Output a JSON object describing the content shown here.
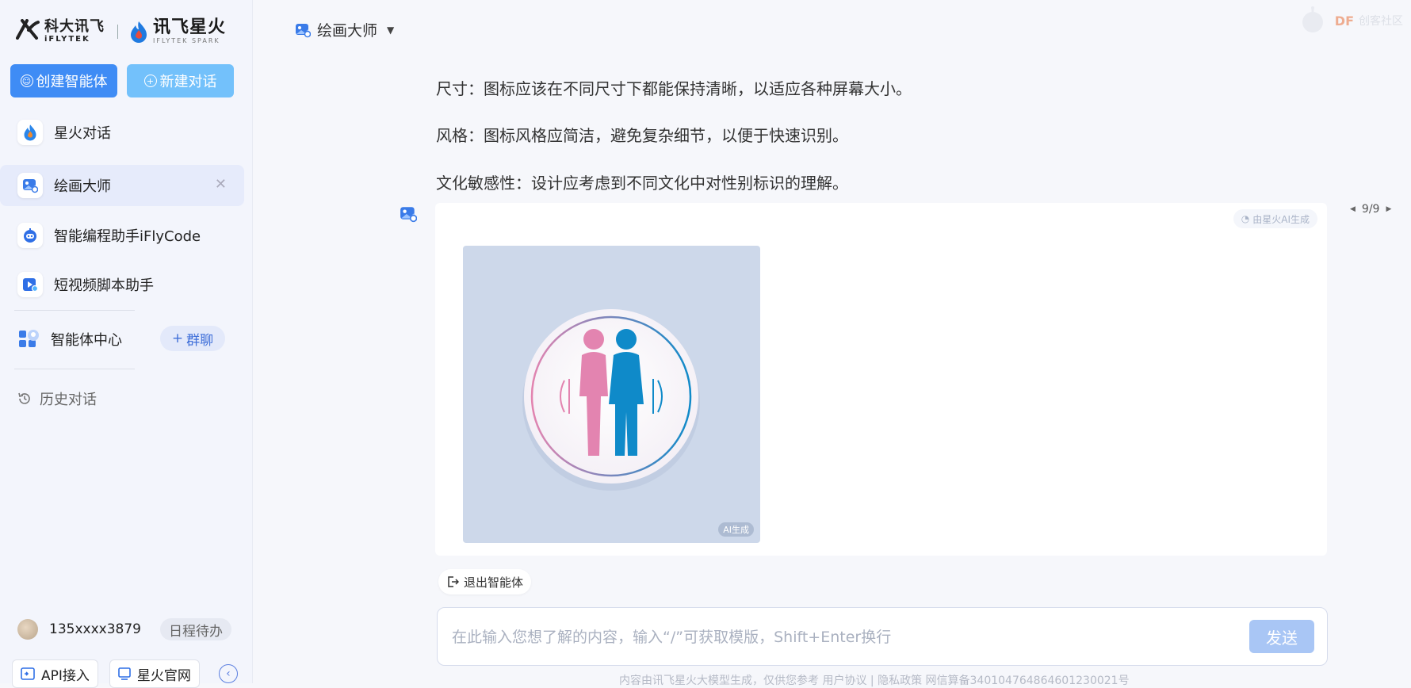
{
  "brand": {
    "iflytek_cn": "科大讯飞",
    "iflytek_en": "iFLYTEK",
    "spark_cn": "讯飞星火",
    "spark_en": "IFLYTEK SPARK"
  },
  "sidebar": {
    "create_agent_label": "创建智能体",
    "new_chat_label": "新建对话",
    "items": [
      {
        "label": "星火对话",
        "icon": "spark-flame-icon"
      },
      {
        "label": "绘画大师",
        "icon": "painting-icon",
        "active": true
      },
      {
        "label": "智能编程助手iFlyCode",
        "icon": "robot-icon"
      },
      {
        "label": "短视频脚本助手",
        "icon": "video-icon"
      }
    ],
    "agent_center_label": "智能体中心",
    "group_chat_label": "群聊",
    "history_label": "历史对话",
    "user_name": "135xxxx3879",
    "todo_label": "日程待办",
    "api_label": "API接入",
    "official_site_label": "星火官网"
  },
  "header": {
    "title": "绘画大师"
  },
  "watermark": {
    "df": "DF",
    "text": "创客社区"
  },
  "chat": {
    "lines": [
      "尺寸：图标应该在不同尺寸下都能保持清晰，以适应各种屏幕大小。",
      "风格：图标风格应简洁，避免复杂细节，以便于快速识别。",
      "文化敏感性：设计应考虑到不同文化中对性别标识的理解。"
    ],
    "ai_tag": "由星火AI生成",
    "image_tag": "AI生成",
    "pager": "9/9",
    "exit_agent_label": "退出智能体"
  },
  "input": {
    "placeholder": "在此输入您想了解的内容，输入“/”可获取模版，Shift+Enter换行",
    "send_label": "发送"
  },
  "footer": {
    "text": "内容由讯飞星火大模型生成，仅供您参考    用户协议 | 隐私政策    网信算备340104764864601230021号"
  },
  "colors": {
    "primary": "#3f8cf5",
    "secondary": "#73c1fb",
    "send_disabled": "#a9c6f5",
    "female": "#e384b0",
    "male": "#0f8ac9"
  }
}
